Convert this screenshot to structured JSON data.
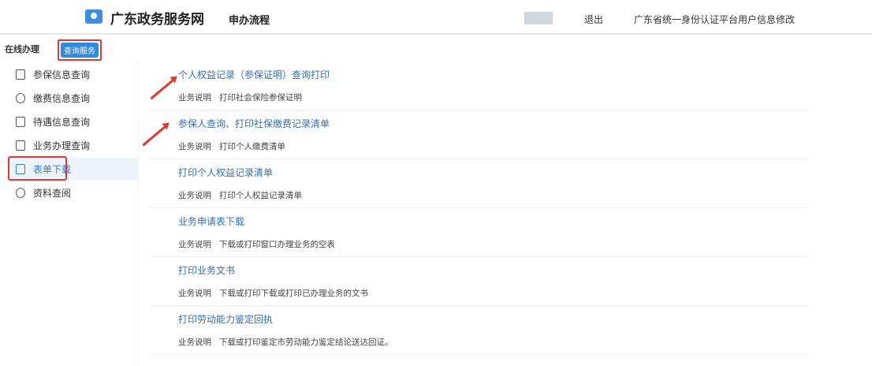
{
  "header": {
    "site_name": "广东政务服务网",
    "process": "申办流程",
    "logout": "退出",
    "modify": "广东省统一身份认证平台用户信息修改"
  },
  "tabs": {
    "online": "在线办理",
    "query": "查询服务"
  },
  "sidebar": {
    "items": [
      {
        "label": "参保信息查询"
      },
      {
        "label": "缴费信息查询"
      },
      {
        "label": "待遇信息查询"
      },
      {
        "label": "业务办理查询"
      },
      {
        "label": "表单下载"
      },
      {
        "label": "资料查阅"
      }
    ]
  },
  "desc_label": "业务说明",
  "services": [
    {
      "title": "个人权益记录（参保证明）查询打印",
      "desc": "打印社会保险参保证明"
    },
    {
      "title": "参保人查询、打印社保缴费记录清单",
      "desc": "打印个人缴费清单"
    },
    {
      "title": "打印个人权益记录清单",
      "desc": "打印个人权益记录清单"
    },
    {
      "title": "业务申请表下载",
      "desc": "下载或打印窗口办理业务的空表"
    },
    {
      "title": "打印业务文书",
      "desc": "下载或打印下载或打印已办理业务的文书"
    },
    {
      "title": "打印劳动能力鉴定回执",
      "desc": "下载或打印鉴定市劳动能力鉴定结论送达回证。"
    }
  ]
}
